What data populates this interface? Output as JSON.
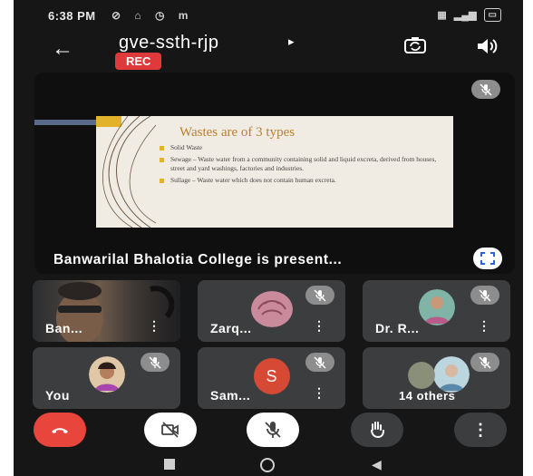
{
  "status_bar": {
    "time": "6:38 PM",
    "notification_icons": "⊘ ⌂ ◷ m"
  },
  "header": {
    "meeting_code": "gve-ssth-rjp",
    "rec_label": "REC"
  },
  "presentation": {
    "presenter_label": "Banwarilal Bhalotia College is present...",
    "slide": {
      "heading": "Wastes are of 3 types",
      "bullets": [
        "Solid Waste",
        "Sewage – Waste water from a community containing solid and liquid excreta, derived from houses, street and yard washings, factories and industries.",
        "Sullage – Waste water which does not contain human excreta."
      ]
    }
  },
  "participants": [
    {
      "name": "Ban...",
      "type": "camera",
      "muted": false
    },
    {
      "name": "Zarq...",
      "type": "rose",
      "muted": true
    },
    {
      "name": "Dr. R...",
      "type": "photo",
      "muted": true
    },
    {
      "name": "You",
      "type": "photo",
      "muted": true
    },
    {
      "name": "Sam...",
      "type": "letter",
      "initial": "S",
      "muted": true
    },
    {
      "name": "14 others",
      "type": "photo",
      "muted": true
    }
  ],
  "colors": {
    "rec": "#e0393b",
    "end_call": "#e8453c",
    "tile_bg": "#3c3d3f",
    "slide_heading": "#b8802e"
  },
  "icons": {
    "back": "arrow-left-icon",
    "switch_camera": "camera-switch-icon",
    "speaker": "speaker-icon",
    "fullscreen": "fullscreen-icon",
    "mic_off": "mic-off-icon",
    "end_call": "end-call-icon",
    "camera_off": "camera-off-icon",
    "raise_hand": "hand-icon",
    "more": "more-vertical-icon"
  }
}
